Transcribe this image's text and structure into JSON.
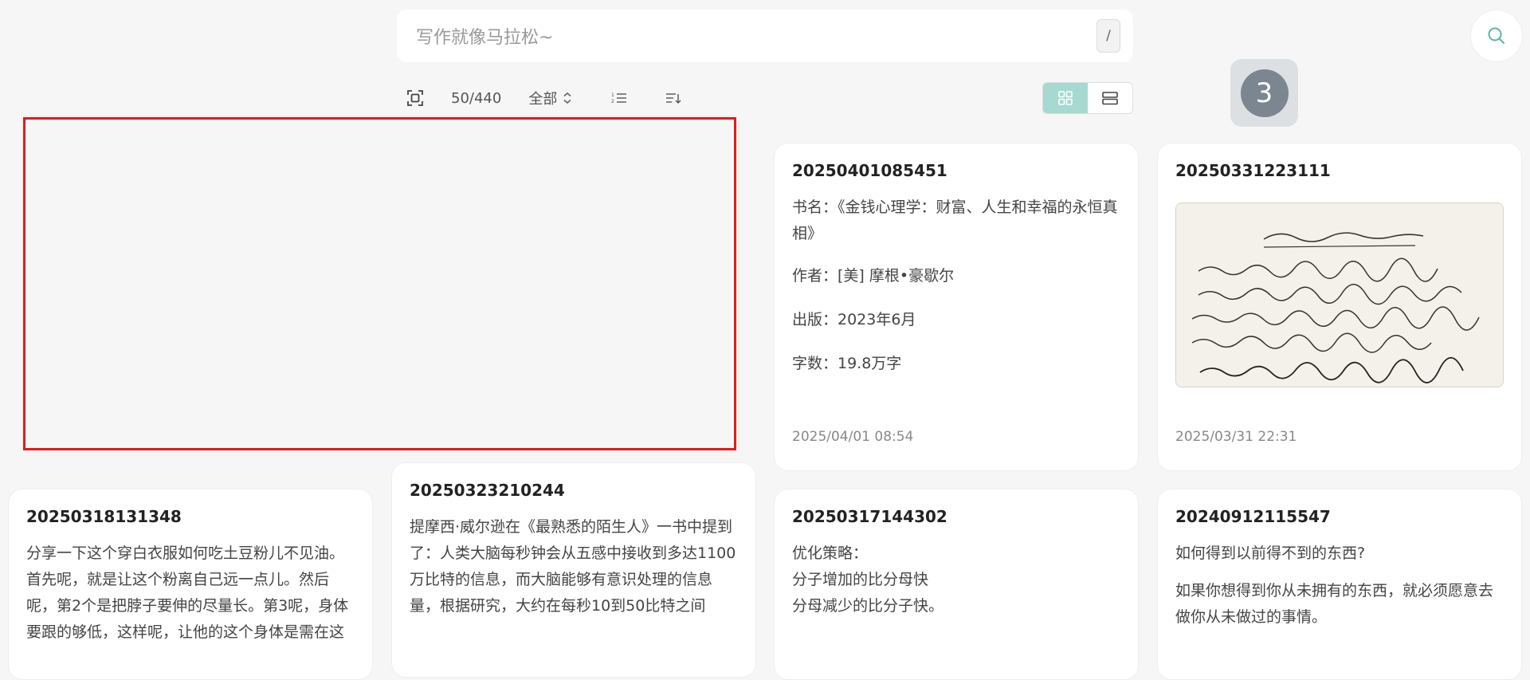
{
  "search": {
    "placeholder": "写作就像马拉松~",
    "shortcut": "/"
  },
  "toolbar": {
    "count": "50/440",
    "filter_label": "全部"
  },
  "badge": {
    "value": "3"
  },
  "colors": {
    "accent": "#a6d9cf",
    "highlight": "#e21a1a",
    "badge": "#7b8691"
  },
  "cards": [
    {
      "title": "20250401085451",
      "lines": [
        "书名：《金钱心理学：财富、人生和幸福的永恒真相》",
        "作者：[美] 摩根•豪歇尔",
        "出版：2023年6月",
        "字数：19.8万字"
      ],
      "date": "2025/04/01 08:54"
    },
    {
      "title": "20250331223111",
      "image": "handwritten-note-photo",
      "date": "2025/03/31 22:31"
    },
    {
      "title": "20250318131348",
      "text": "分享一下这个穿白衣服如何吃土豆粉儿不见油。首先呢，就是让这个粉离自己远一点儿。然后呢，第2个是把脖子要伸的尽量长。第3呢，身体要跟的够低，这样呢，让他的这个身体是需在这"
    },
    {
      "title": "20250323210244",
      "text": "提摩西·威尔逊在《最熟悉的陌生人》一书中提到了：人类大脑每秒钟会从五感中接收到多达1100万比特的信息，而大脑能够有意识处理的信息量，根据研究，大约在每秒10到50比特之间"
    },
    {
      "title": "20250317144302",
      "lines": [
        "优化策略：",
        "分子增加的比分母快",
        "分母减少的比分子快。"
      ]
    },
    {
      "title": "20240912115547",
      "lines": [
        "如何得到以前得不到的东西?",
        "如果你想得到你从未拥有的东西，就必须愿意去做你从未做过的事情。"
      ]
    }
  ]
}
